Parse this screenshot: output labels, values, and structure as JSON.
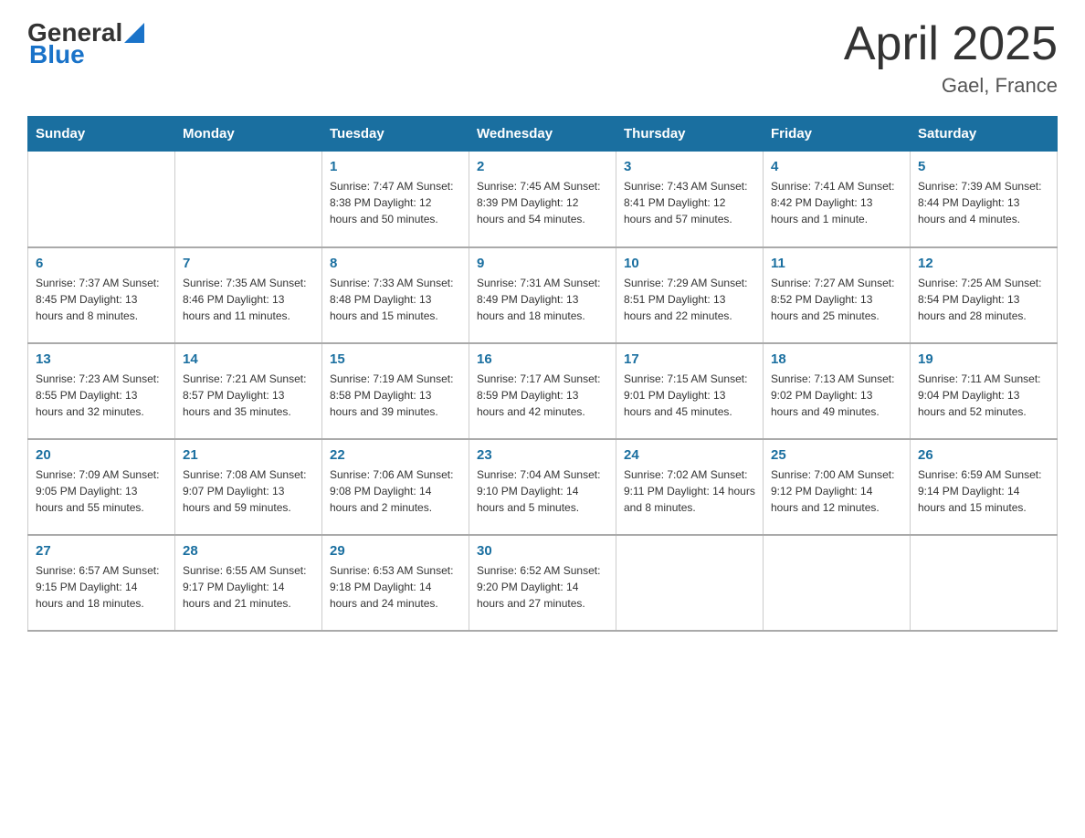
{
  "header": {
    "logo_general": "General",
    "logo_blue": "Blue",
    "title": "April 2025",
    "subtitle": "Gael, France"
  },
  "weekdays": [
    "Sunday",
    "Monday",
    "Tuesday",
    "Wednesday",
    "Thursday",
    "Friday",
    "Saturday"
  ],
  "weeks": [
    [
      {
        "day": "",
        "info": ""
      },
      {
        "day": "",
        "info": ""
      },
      {
        "day": "1",
        "info": "Sunrise: 7:47 AM\nSunset: 8:38 PM\nDaylight: 12 hours\nand 50 minutes."
      },
      {
        "day": "2",
        "info": "Sunrise: 7:45 AM\nSunset: 8:39 PM\nDaylight: 12 hours\nand 54 minutes."
      },
      {
        "day": "3",
        "info": "Sunrise: 7:43 AM\nSunset: 8:41 PM\nDaylight: 12 hours\nand 57 minutes."
      },
      {
        "day": "4",
        "info": "Sunrise: 7:41 AM\nSunset: 8:42 PM\nDaylight: 13 hours\nand 1 minute."
      },
      {
        "day": "5",
        "info": "Sunrise: 7:39 AM\nSunset: 8:44 PM\nDaylight: 13 hours\nand 4 minutes."
      }
    ],
    [
      {
        "day": "6",
        "info": "Sunrise: 7:37 AM\nSunset: 8:45 PM\nDaylight: 13 hours\nand 8 minutes."
      },
      {
        "day": "7",
        "info": "Sunrise: 7:35 AM\nSunset: 8:46 PM\nDaylight: 13 hours\nand 11 minutes."
      },
      {
        "day": "8",
        "info": "Sunrise: 7:33 AM\nSunset: 8:48 PM\nDaylight: 13 hours\nand 15 minutes."
      },
      {
        "day": "9",
        "info": "Sunrise: 7:31 AM\nSunset: 8:49 PM\nDaylight: 13 hours\nand 18 minutes."
      },
      {
        "day": "10",
        "info": "Sunrise: 7:29 AM\nSunset: 8:51 PM\nDaylight: 13 hours\nand 22 minutes."
      },
      {
        "day": "11",
        "info": "Sunrise: 7:27 AM\nSunset: 8:52 PM\nDaylight: 13 hours\nand 25 minutes."
      },
      {
        "day": "12",
        "info": "Sunrise: 7:25 AM\nSunset: 8:54 PM\nDaylight: 13 hours\nand 28 minutes."
      }
    ],
    [
      {
        "day": "13",
        "info": "Sunrise: 7:23 AM\nSunset: 8:55 PM\nDaylight: 13 hours\nand 32 minutes."
      },
      {
        "day": "14",
        "info": "Sunrise: 7:21 AM\nSunset: 8:57 PM\nDaylight: 13 hours\nand 35 minutes."
      },
      {
        "day": "15",
        "info": "Sunrise: 7:19 AM\nSunset: 8:58 PM\nDaylight: 13 hours\nand 39 minutes."
      },
      {
        "day": "16",
        "info": "Sunrise: 7:17 AM\nSunset: 8:59 PM\nDaylight: 13 hours\nand 42 minutes."
      },
      {
        "day": "17",
        "info": "Sunrise: 7:15 AM\nSunset: 9:01 PM\nDaylight: 13 hours\nand 45 minutes."
      },
      {
        "day": "18",
        "info": "Sunrise: 7:13 AM\nSunset: 9:02 PM\nDaylight: 13 hours\nand 49 minutes."
      },
      {
        "day": "19",
        "info": "Sunrise: 7:11 AM\nSunset: 9:04 PM\nDaylight: 13 hours\nand 52 minutes."
      }
    ],
    [
      {
        "day": "20",
        "info": "Sunrise: 7:09 AM\nSunset: 9:05 PM\nDaylight: 13 hours\nand 55 minutes."
      },
      {
        "day": "21",
        "info": "Sunrise: 7:08 AM\nSunset: 9:07 PM\nDaylight: 13 hours\nand 59 minutes."
      },
      {
        "day": "22",
        "info": "Sunrise: 7:06 AM\nSunset: 9:08 PM\nDaylight: 14 hours\nand 2 minutes."
      },
      {
        "day": "23",
        "info": "Sunrise: 7:04 AM\nSunset: 9:10 PM\nDaylight: 14 hours\nand 5 minutes."
      },
      {
        "day": "24",
        "info": "Sunrise: 7:02 AM\nSunset: 9:11 PM\nDaylight: 14 hours\nand 8 minutes."
      },
      {
        "day": "25",
        "info": "Sunrise: 7:00 AM\nSunset: 9:12 PM\nDaylight: 14 hours\nand 12 minutes."
      },
      {
        "day": "26",
        "info": "Sunrise: 6:59 AM\nSunset: 9:14 PM\nDaylight: 14 hours\nand 15 minutes."
      }
    ],
    [
      {
        "day": "27",
        "info": "Sunrise: 6:57 AM\nSunset: 9:15 PM\nDaylight: 14 hours\nand 18 minutes."
      },
      {
        "day": "28",
        "info": "Sunrise: 6:55 AM\nSunset: 9:17 PM\nDaylight: 14 hours\nand 21 minutes."
      },
      {
        "day": "29",
        "info": "Sunrise: 6:53 AM\nSunset: 9:18 PM\nDaylight: 14 hours\nand 24 minutes."
      },
      {
        "day": "30",
        "info": "Sunrise: 6:52 AM\nSunset: 9:20 PM\nDaylight: 14 hours\nand 27 minutes."
      },
      {
        "day": "",
        "info": ""
      },
      {
        "day": "",
        "info": ""
      },
      {
        "day": "",
        "info": ""
      }
    ]
  ]
}
